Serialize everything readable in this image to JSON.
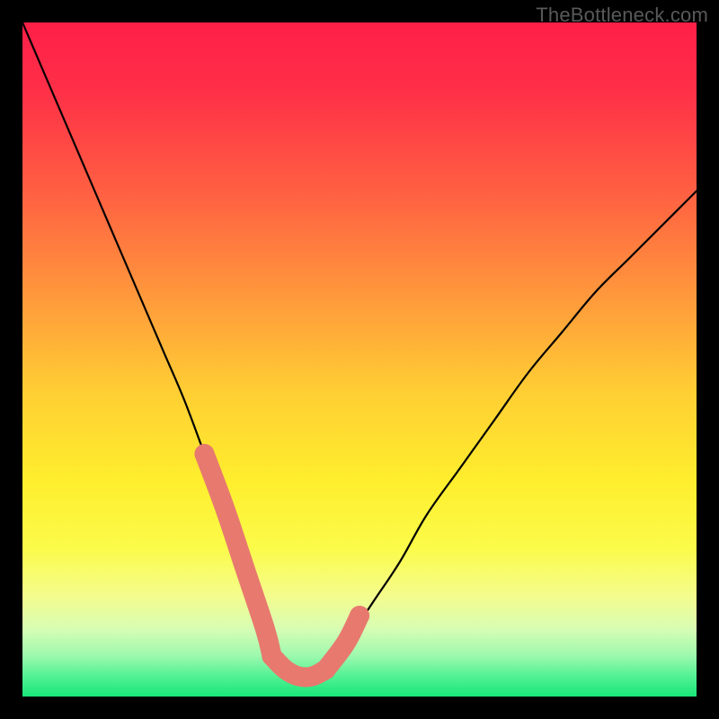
{
  "watermark": "TheBottleneck.com",
  "chart_data": {
    "type": "line",
    "title": "",
    "xlabel": "",
    "ylabel": "",
    "xlim": [
      0,
      100
    ],
    "ylim": [
      0,
      100
    ],
    "grid": false,
    "legend": false,
    "series": [
      {
        "name": "bottleneck-curve",
        "x": [
          0,
          3,
          6,
          9,
          12,
          15,
          18,
          21,
          24,
          27,
          30,
          33,
          36,
          37,
          39,
          41,
          43,
          45,
          48,
          52,
          56,
          60,
          65,
          70,
          75,
          80,
          85,
          90,
          95,
          100
        ],
        "y": [
          100,
          93,
          86,
          79,
          72,
          65,
          58,
          51,
          44,
          36,
          28,
          19,
          10,
          6,
          4,
          3,
          3,
          4,
          8,
          14,
          20,
          27,
          34,
          41,
          48,
          54,
          60,
          65,
          70,
          75
        ],
        "color": "#000000"
      }
    ],
    "annotations": {
      "optimal_zone_color": "#e8796f",
      "optimal_segments": [
        {
          "x": [
            27,
            30,
            33,
            36,
            37
          ],
          "y": [
            36,
            28,
            19,
            10,
            6
          ]
        },
        {
          "x": [
            37,
            39,
            41,
            43,
            45
          ],
          "y": [
            6,
            4,
            3,
            3,
            4
          ]
        },
        {
          "x": [
            45,
            48,
            50
          ],
          "y": [
            4,
            8,
            12
          ]
        }
      ]
    },
    "background_gradient": {
      "stops": [
        {
          "offset": 0.0,
          "color": "#ff1f48"
        },
        {
          "offset": 0.1,
          "color": "#ff2f48"
        },
        {
          "offset": 0.25,
          "color": "#ff5f42"
        },
        {
          "offset": 0.4,
          "color": "#ff963c"
        },
        {
          "offset": 0.55,
          "color": "#ffcf33"
        },
        {
          "offset": 0.68,
          "color": "#feee2d"
        },
        {
          "offset": 0.78,
          "color": "#fbfb4a"
        },
        {
          "offset": 0.85,
          "color": "#f4fc8c"
        },
        {
          "offset": 0.9,
          "color": "#d7fdb4"
        },
        {
          "offset": 0.94,
          "color": "#9cf9ae"
        },
        {
          "offset": 0.97,
          "color": "#52f193"
        },
        {
          "offset": 1.0,
          "color": "#18e678"
        }
      ]
    }
  }
}
